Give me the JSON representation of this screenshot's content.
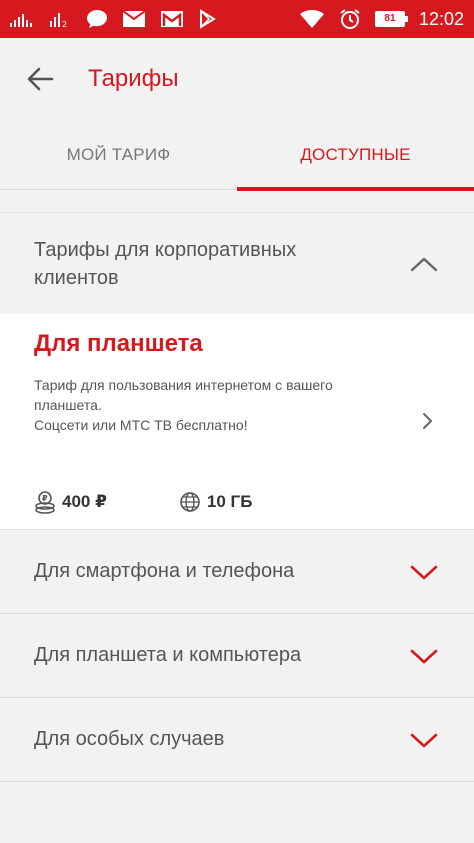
{
  "status_bar": {
    "time": "12:02",
    "battery_level": "81",
    "icons": [
      "signal-bars-icon",
      "signal-bars-2-icon",
      "chat-bubble-icon",
      "mail-icon",
      "gmail-icon",
      "play-store-icon",
      "wifi-icon",
      "alarm-icon",
      "battery-icon"
    ]
  },
  "appbar": {
    "title": "Тарифы",
    "back_icon": "arrow-back-icon"
  },
  "tabs": [
    {
      "label": "МОЙ ТАРИФ",
      "active": false
    },
    {
      "label": "ДОСТУПНЫЕ",
      "active": true
    }
  ],
  "expanded_section": {
    "title": "Тарифы для корпоративных клиентов",
    "chevron": "chevron-up-icon",
    "card": {
      "title": "Для планшета",
      "description_lines": [
        "Тариф для пользования интернетом с вашего",
        "планшета.",
        "Соцсети или МТС ТВ бесплатно!"
      ],
      "price": "400 ₽",
      "data": "10 ГБ",
      "price_icon": "coins-icon",
      "data_icon": "globe-icon",
      "arrow_icon": "chevron-right-icon"
    }
  },
  "collapsed_sections": [
    {
      "label": "Для смартфона и телефона"
    },
    {
      "label": "Для планшета и компьютера"
    },
    {
      "label": "Для особых случаев"
    }
  ],
  "colors": {
    "accent": "#d6191f",
    "background": "#f2f2f2",
    "card": "#ffffff",
    "text": "#555555"
  }
}
